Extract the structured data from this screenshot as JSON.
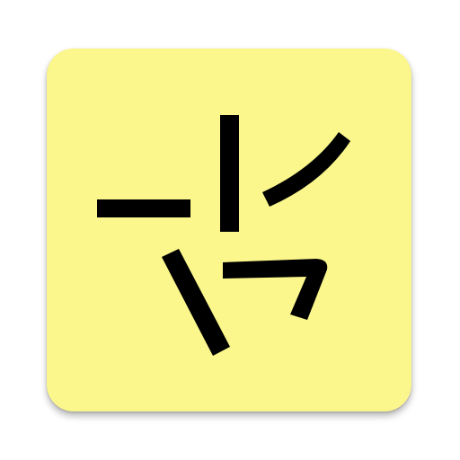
{
  "app_icon": {
    "name": "puzzle-strokes-app-icon",
    "background_color": "#fbf78c",
    "stroke_color": "#000000",
    "shadow_color": "#9a9a9a"
  }
}
